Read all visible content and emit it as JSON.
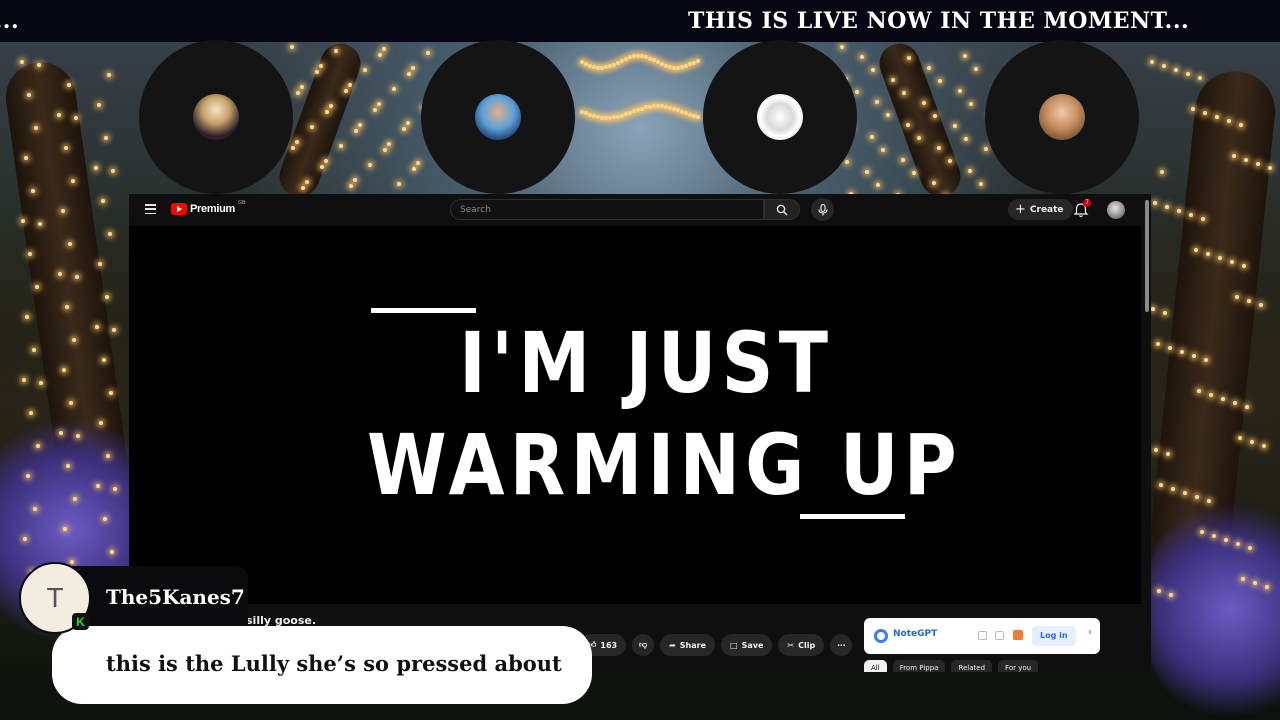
{
  "ticker": {
    "fragment": "NT...",
    "text": "THIS IS LIVE NOW IN THE MOMENT..."
  },
  "participants": [
    {
      "icon": "participant-avatar-woman-dark-hair"
    },
    {
      "icon": "participant-avatar-man-illustrated"
    },
    {
      "icon": "participant-avatar-mascot-drawing"
    },
    {
      "icon": "participant-avatar-woman-smiling"
    }
  ],
  "youtube": {
    "logo": "Premium",
    "region": "GB",
    "search_placeholder": "Search",
    "create_label": "Create",
    "notification_count": "7",
    "video_title_line1": "I'M JUST",
    "video_title_line2": "WARMING UP",
    "description_snippet": "silly goose.",
    "like_count": "163",
    "share_label": "Share",
    "save_label": "Save",
    "clip_label": "Clip",
    "notegpt": {
      "name": "NoteGPT",
      "login": "Log in"
    },
    "chips": [
      "All",
      "From Pippa",
      "Related",
      "For you"
    ]
  },
  "chat": {
    "avatar_letter": "T",
    "platform_badge": "K",
    "username": "The5Kanes7",
    "message": "this is the Lully she’s so pressed about"
  },
  "colors": {
    "accent_red": "#ff0000",
    "kick_green": "#3ad32e",
    "notegpt_blue": "#1e66d8"
  }
}
